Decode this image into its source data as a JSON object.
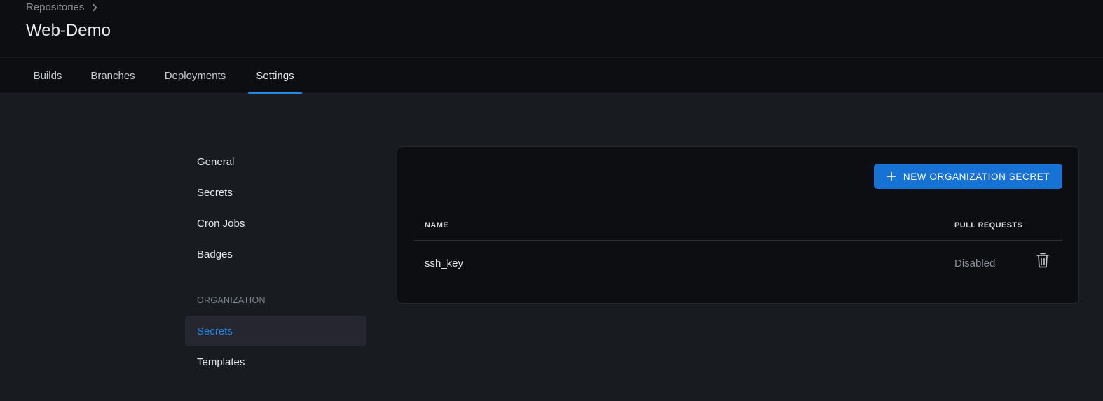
{
  "header": {
    "breadcrumb": "Repositories",
    "title": "Web-Demo"
  },
  "tabs": [
    {
      "label": "Builds",
      "active": false
    },
    {
      "label": "Branches",
      "active": false
    },
    {
      "label": "Deployments",
      "active": false
    },
    {
      "label": "Settings",
      "active": true
    }
  ],
  "sidebar": {
    "items": [
      {
        "label": "General"
      },
      {
        "label": "Secrets"
      },
      {
        "label": "Cron Jobs"
      },
      {
        "label": "Badges"
      }
    ],
    "org_heading": "ORGANIZATION",
    "org_items": [
      {
        "label": "Secrets",
        "active": true
      },
      {
        "label": "Templates",
        "active": false
      }
    ]
  },
  "secrets": {
    "new_button_label": "NEW ORGANIZATION SECRET",
    "columns": [
      "NAME",
      "PULL REQUESTS"
    ],
    "rows": [
      {
        "name": "ssh_key",
        "pull_requests": "Disabled"
      }
    ]
  },
  "icons": {
    "breadcrumb_separator": "chevron-right-icon",
    "new_button": "plus-icon",
    "row_action": "trash-icon"
  },
  "colors": {
    "accent": "#1672d4",
    "active_tab_underline": "#1e88e5",
    "active_sidebar_text": "#1e88e5"
  }
}
